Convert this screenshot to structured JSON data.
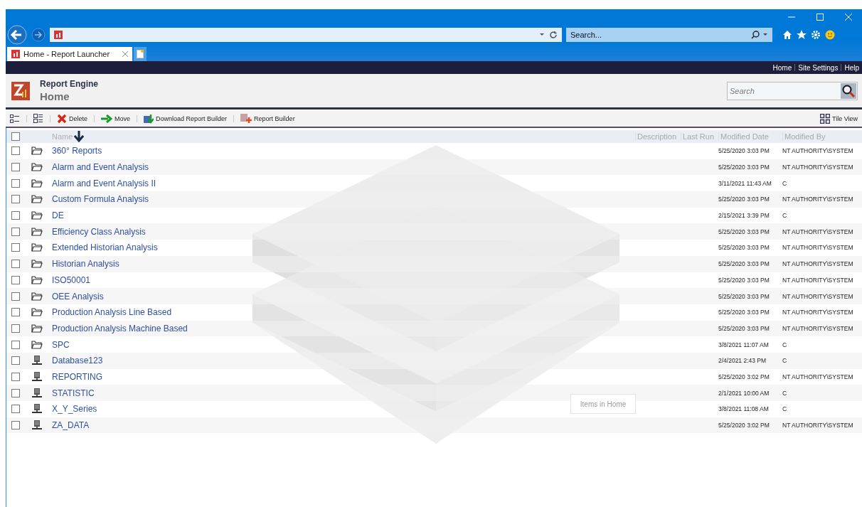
{
  "browser": {
    "search_placeholder": "Search...",
    "tab_title": "Home - Report Launcher"
  },
  "top_links": [
    "Home",
    "Site Settings",
    "Help"
  ],
  "header": {
    "app_name": "Report Engine",
    "page_title": "Home",
    "search_placeholder": "Search"
  },
  "toolbar": {
    "actions": [
      {
        "label": "Delete",
        "kind": "delete"
      },
      {
        "label": "Move",
        "kind": "move"
      },
      {
        "label": "Download Report Builder",
        "kind": "download"
      },
      {
        "label": "Report Builder",
        "kind": "builder"
      }
    ],
    "tile_view": "Tile View"
  },
  "table": {
    "columns": [
      "Name",
      "Description",
      "Last Run",
      "Modified Date",
      "Modified By"
    ],
    "select_all_checked": false,
    "rows": [
      {
        "name": "360° Reports",
        "kind": "folder",
        "modified_date": "5/25/2020 3:03 PM",
        "modified_by": "NT AUTHORITY\\SYSTEM",
        "checked": false
      },
      {
        "name": "Alarm and Event Analysis",
        "kind": "folder",
        "modified_date": "5/25/2020 3:03 PM",
        "modified_by": "NT AUTHORITY\\SYSTEM",
        "checked": false
      },
      {
        "name": "Alarm and Event Analysis II",
        "kind": "folder",
        "modified_date": "3/11/2021 11:43 AM",
        "modified_by": "C",
        "checked": false
      },
      {
        "name": "Custom Formula Analysis",
        "kind": "folder",
        "modified_date": "5/25/2020 3:03 PM",
        "modified_by": "NT AUTHORITY\\SYSTEM",
        "checked": false
      },
      {
        "name": "DE",
        "kind": "folder",
        "modified_date": "2/15/2021 3:39 PM",
        "modified_by": "C",
        "checked": false
      },
      {
        "name": "Efficiency Class Analysis",
        "kind": "folder",
        "modified_date": "5/25/2020 3:03 PM",
        "modified_by": "NT AUTHORITY\\SYSTEM",
        "checked": false
      },
      {
        "name": "Extended Historian Analysis",
        "kind": "folder",
        "modified_date": "5/25/2020 3:03 PM",
        "modified_by": "NT AUTHORITY\\SYSTEM",
        "checked": false
      },
      {
        "name": "Historian Analysis",
        "kind": "folder",
        "modified_date": "5/25/2020 3:03 PM",
        "modified_by": "NT AUTHORITY\\SYSTEM",
        "checked": false
      },
      {
        "name": "ISO50001",
        "kind": "folder",
        "modified_date": "5/25/2020 3:03 PM",
        "modified_by": "NT AUTHORITY\\SYSTEM",
        "checked": false
      },
      {
        "name": "OEE Analysis",
        "kind": "folder",
        "modified_date": "5/25/2020 3:03 PM",
        "modified_by": "NT AUTHORITY\\SYSTEM",
        "checked": false
      },
      {
        "name": "Production Analysis Line Based",
        "kind": "folder",
        "modified_date": "5/25/2020 3:03 PM",
        "modified_by": "NT AUTHORITY\\SYSTEM",
        "checked": false
      },
      {
        "name": "Production Analysis Machine Based",
        "kind": "folder",
        "modified_date": "5/25/2020 3:03 PM",
        "modified_by": "NT AUTHORITY\\SYSTEM",
        "checked": false
      },
      {
        "name": "SPC",
        "kind": "folder",
        "modified_date": "3/8/2021 11:07 AM",
        "modified_by": "C",
        "checked": false
      },
      {
        "name": "Database123",
        "kind": "datasource",
        "modified_date": "2/4/2021 2:43 PM",
        "modified_by": "C",
        "checked": false
      },
      {
        "name": "REPORTING",
        "kind": "datasource",
        "modified_date": "5/25/2020 3:02 PM",
        "modified_by": "NT AUTHORITY\\SYSTEM",
        "checked": false
      },
      {
        "name": "STATISTIC",
        "kind": "datasource",
        "modified_date": "2/1/2021 10:00 AM",
        "modified_by": "C",
        "checked": false
      },
      {
        "name": "X_Y_Series",
        "kind": "datasource",
        "modified_date": "3/8/2021 11:08 AM",
        "modified_by": "C",
        "checked": false
      },
      {
        "name": "ZA_DATA",
        "kind": "datasource",
        "modified_date": "5/25/2020 3:02 PM",
        "modified_by": "NT AUTHORITY\\SYSTEM",
        "checked": false
      }
    ]
  },
  "empty_hint": "Items in Home"
}
